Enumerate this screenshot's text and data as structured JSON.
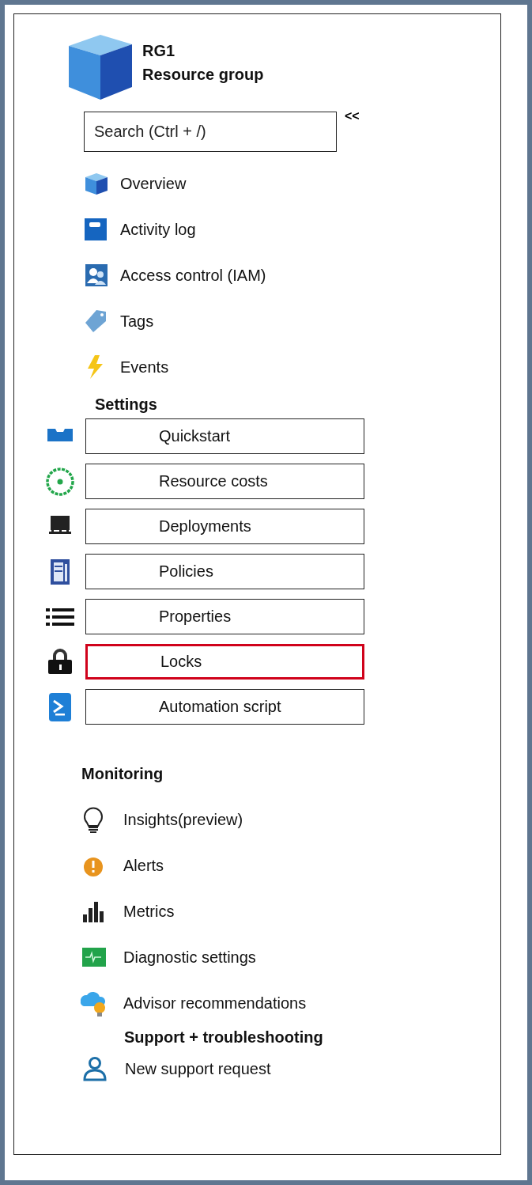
{
  "header": {
    "title": "RG1",
    "subtitle": "Resource group"
  },
  "search": {
    "placeholder": "Search (Ctrl + /)"
  },
  "collapse": "<<",
  "nav_items": [
    {
      "label": "Overview"
    },
    {
      "label": "Activity log"
    },
    {
      "label": "Access control (IAM)"
    },
    {
      "label": "Tags"
    },
    {
      "label": "Events"
    }
  ],
  "settings": {
    "heading": "Settings",
    "items": [
      {
        "label": "Quickstart",
        "selected": false
      },
      {
        "label": "Resource costs",
        "selected": false
      },
      {
        "label": "Deployments",
        "selected": false
      },
      {
        "label": "Policies",
        "selected": false
      },
      {
        "label": "Properties",
        "selected": false
      },
      {
        "label": "Locks",
        "selected": true
      },
      {
        "label": "Automation script",
        "selected": false
      }
    ]
  },
  "monitoring": {
    "heading": "Monitoring",
    "items": [
      {
        "label": "Insights(preview)"
      },
      {
        "label": "Alerts"
      },
      {
        "label": "Metrics"
      },
      {
        "label": "Diagnostic settings"
      },
      {
        "label": "Advisor recommendations"
      }
    ]
  },
  "support": {
    "heading": "Support + troubleshooting",
    "items": [
      {
        "label": "New support request"
      }
    ]
  }
}
